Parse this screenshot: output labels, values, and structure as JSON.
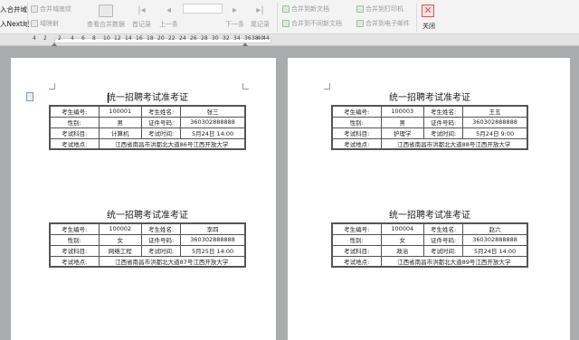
{
  "ribbon": {
    "left_labels": [
      "入合并域",
      "入Next域"
    ],
    "group1": [
      {
        "label": "合并域底纹",
        "icon": "shading-icon"
      },
      {
        "label": "域映射",
        "icon": "field-map-icon"
      }
    ],
    "view_merged_label": "查看合并数据",
    "first_record_label": "首记录",
    "prev_label": "上一条",
    "next_label": "下一条",
    "last_record_label": "尾记录",
    "group3": [
      {
        "label": "合并到新文档",
        "icon": "merge-new-doc-icon"
      },
      {
        "label": "合并到不同新文档",
        "icon": "merge-diff-docs-icon"
      }
    ],
    "group4": [
      {
        "label": "合并到打印机",
        "icon": "merge-printer-icon"
      },
      {
        "label": "合并到电子邮件",
        "icon": "merge-email-icon"
      }
    ],
    "close_label": "关闭"
  },
  "ruler": {
    "left_numbers": [
      "4",
      "2",
      "2"
    ],
    "right_numbers": [
      "4",
      "6",
      "8",
      "10",
      "12",
      "14",
      "16",
      "18",
      "20",
      "22",
      "24",
      "26",
      "28",
      "30",
      "32",
      "34",
      "36",
      "38",
      "40",
      "44"
    ]
  },
  "tickets": [
    {
      "title": "统一招聘考试准考证",
      "id_label": "考生编号:",
      "id": "100001",
      "name_label": "考生姓名:",
      "name": "张三",
      "gender_label": "性别:",
      "gender": "男",
      "cert_label": "证件号码:",
      "cert": "360302888888",
      "subject_label": "考试科目:",
      "subject": "计算机",
      "time_label": "考试时间:",
      "time": "5月24日 14:00",
      "place_label": "考试地点:",
      "place": "江西省南昌市洪都北大道86号江西开放大学"
    },
    {
      "title": "统一招聘考试准考证",
      "id_label": "考生编号:",
      "id": "100003",
      "name_label": "考生姓名:",
      "name": "王五",
      "gender_label": "性别:",
      "gender": "男",
      "cert_label": "证件号码:",
      "cert": "360302888888",
      "subject_label": "考试科目:",
      "subject": "护理学",
      "time_label": "考试时间:",
      "time": "5月24日 9:00",
      "place_label": "考试地点:",
      "place": "江西省南昌市洪都北大道88号江西开放大学"
    },
    {
      "title": "统一招聘考试准考证",
      "id_label": "考生编号:",
      "id": "100002",
      "name_label": "考生姓名:",
      "name": "李四",
      "gender_label": "性别:",
      "gender": "女",
      "cert_label": "证件号码:",
      "cert": "360302888888",
      "subject_label": "考试科目:",
      "subject": "网络工程",
      "time_label": "考试时间:",
      "time": "5月25日 14:00",
      "place_label": "考试地点:",
      "place": "江西省南昌市洪都北大道87号江西开放大学"
    },
    {
      "title": "统一招聘考试准考证",
      "id_label": "考生编号:",
      "id": "100004",
      "name_label": "考生姓名:",
      "name": "赵六",
      "gender_label": "性别:",
      "gender": "女",
      "cert_label": "证件号码:",
      "cert": "360302888888",
      "subject_label": "考试科目:",
      "subject": "政治",
      "time_label": "考试时间:",
      "time": "5月24日 14:00",
      "place_label": "考试地点:",
      "place": "江西省南昌市洪都北大道89号江西开放大学"
    }
  ]
}
